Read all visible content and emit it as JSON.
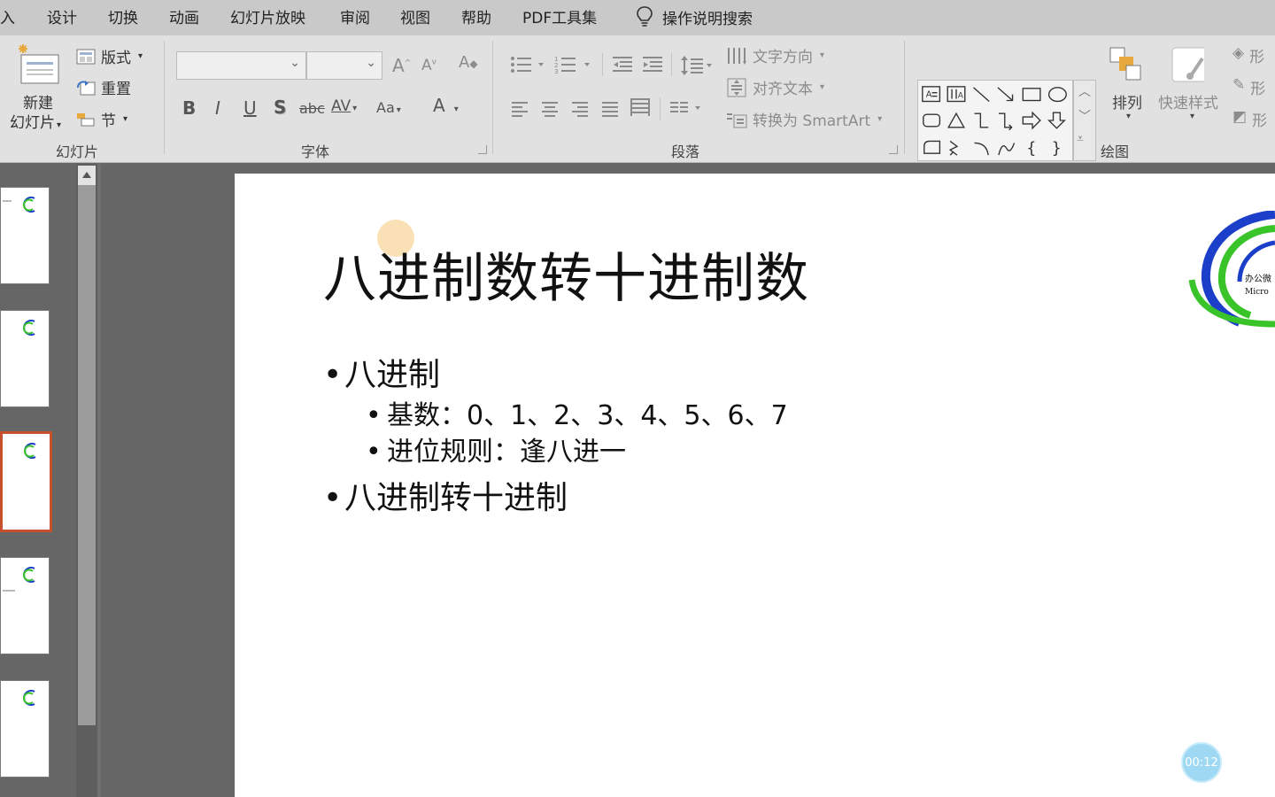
{
  "tabs": [
    {
      "label": "入"
    },
    {
      "label": "设计"
    },
    {
      "label": "切换"
    },
    {
      "label": "动画"
    },
    {
      "label": "幻灯片放映"
    },
    {
      "label": "审阅"
    },
    {
      "label": "视图"
    },
    {
      "label": "帮助"
    },
    {
      "label": "PDF工具集"
    }
  ],
  "tell_me": "操作说明搜索",
  "ribbon": {
    "slides_group": {
      "new_slide_line1": "新建",
      "new_slide_line2": "幻灯片",
      "layout": "版式",
      "reset": "重置",
      "section": "节",
      "label": "幻灯片"
    },
    "font_group": {
      "bold": "B",
      "italic": "I",
      "underline": "U",
      "shadow": "S",
      "strike": "abc",
      "spacing": "AV",
      "case": "Aa",
      "color": "A",
      "grow": "A",
      "shrink": "A",
      "label": "字体"
    },
    "paragraph_group": {
      "text_direction": "文字方向",
      "align_text": "对齐文本",
      "convert_smartart": "转换为 SmartArt",
      "label": "段落"
    },
    "drawing_group": {
      "arrange": "排列",
      "quick_styles": "快速样式",
      "shape_fill": "形",
      "shape_outline": "形",
      "shape_effects": "形",
      "label": "绘图"
    }
  },
  "slide": {
    "title": "八进制数转十进制数",
    "bullets": [
      {
        "level": 1,
        "text": "八进制"
      },
      {
        "level": 2,
        "text": "基数：0、1、2、3、4、5、6、7"
      },
      {
        "level": 2,
        "text": "进位规则：逢八进一"
      },
      {
        "level": 1,
        "text": "八进制转十进制"
      }
    ],
    "logo_text_cn": "办公微",
    "logo_text_en": "Micro"
  },
  "timer": "00:12",
  "colors": {
    "accent_thumb_border": "#c6512c",
    "logo_blue": "#1b3fc9",
    "logo_green": "#39c42a",
    "timer_bg": "#9fd8f3"
  }
}
